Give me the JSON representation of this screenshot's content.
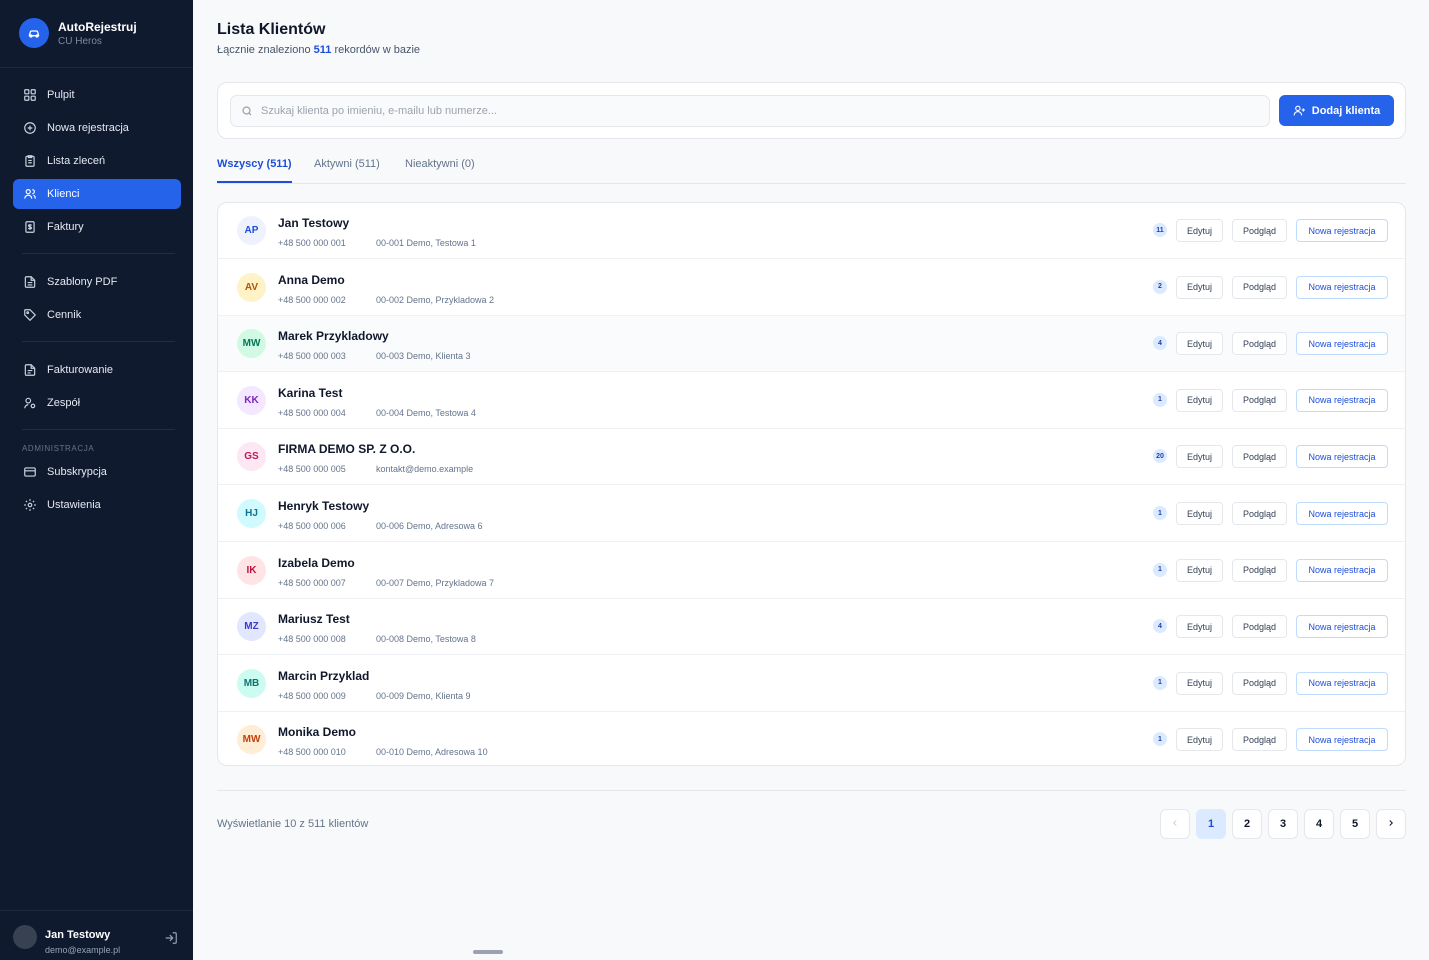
{
  "brand": {
    "title": "AutoRejestruj",
    "subtitle": "CU Heros",
    "icon": "car-icon"
  },
  "nav": {
    "items": [
      {
        "label": "Pulpit",
        "icon": "grid-icon"
      },
      {
        "label": "Nowa rejestracja",
        "icon": "plus-circle-icon"
      },
      {
        "label": "Lista zleceń",
        "icon": "clipboard-icon"
      },
      {
        "label": "Klienci",
        "icon": "users-icon",
        "active": true
      },
      {
        "label": "Faktury",
        "icon": "invoice-icon"
      },
      {
        "label": "Szablony PDF",
        "icon": "file-icon"
      },
      {
        "label": "Cennik",
        "icon": "tag-icon"
      },
      {
        "label": "Fakturowanie",
        "icon": "file-text-icon"
      },
      {
        "label": "Zespół",
        "icon": "user-gear-icon"
      },
      {
        "label": "Subskrypcja",
        "icon": "card-icon"
      },
      {
        "label": "Ustawienia",
        "icon": "gear-icon"
      }
    ],
    "section_admin": "ADMINISTRACJA"
  },
  "user": {
    "name": "Jan Testowy",
    "email": "demo@example.pl",
    "logout_icon": "logout-icon"
  },
  "header": {
    "title": "Lista Klientów",
    "subtitle_prefix": "Łącznie znaleziono",
    "count": "511",
    "subtitle_suffix": "rekordów w bazie"
  },
  "search": {
    "placeholder": "Szukaj klienta po imieniu, e-mailu lub numerze...",
    "value": ""
  },
  "add_button": "Dodaj klienta",
  "tabs": [
    {
      "label": "Wszyscy (511)",
      "active": true
    },
    {
      "label": "Aktywni (511)"
    },
    {
      "label": "Nieaktywni (0)"
    }
  ],
  "actions": {
    "edit": "Edytuj",
    "view": "Podgląd",
    "new": "Nowa rejestracja"
  },
  "clients": [
    {
      "initials": "AP",
      "name": "Jan Testowy",
      "phone": "+48 500 000 001",
      "detail": "00-001 Demo, Testowa 1",
      "count": "11",
      "bg": "#eef2ff",
      "fg": "#1d4ed8"
    },
    {
      "initials": "AV",
      "name": "Anna Demo",
      "phone": "+48 500 000 002",
      "detail": "00-002 Demo, Przykladowa 2",
      "count": "2",
      "bg": "#fef3c7",
      "fg": "#b45309"
    },
    {
      "initials": "MW",
      "name": "Marek Przykladowy",
      "phone": "+48 500 000 003",
      "detail": "00-003 Demo, Klienta 3",
      "count": "4",
      "bg": "#d1fae5",
      "fg": "#047857"
    },
    {
      "initials": "KK",
      "name": "Karina Test",
      "phone": "+48 500 000 004",
      "detail": "00-004 Demo, Testowa 4",
      "count": "1",
      "bg": "#f3e8ff",
      "fg": "#7e22ce"
    },
    {
      "initials": "GS",
      "name": "FIRMA DEMO SP. Z O.O.",
      "phone": "+48 500 000 005",
      "detail": "kontakt@demo.example",
      "count": "20",
      "bg": "#fce7f3",
      "fg": "#be185d"
    },
    {
      "initials": "HJ",
      "name": "Henryk Testowy",
      "phone": "+48 500 000 006",
      "detail": "00-006 Demo, Adresowa 6",
      "count": "1",
      "bg": "#cffafe",
      "fg": "#0e7490"
    },
    {
      "initials": "IK",
      "name": "Izabela Demo",
      "phone": "+48 500 000 007",
      "detail": "00-007 Demo, Przykladowa 7",
      "count": "1",
      "bg": "#ffe4e6",
      "fg": "#be123c"
    },
    {
      "initials": "MZ",
      "name": "Mariusz Test",
      "phone": "+48 500 000 008",
      "detail": "00-008 Demo, Testowa 8",
      "count": "4",
      "bg": "#e0e7ff",
      "fg": "#4338ca"
    },
    {
      "initials": "MB",
      "name": "Marcin Przyklad",
      "phone": "+48 500 000 009",
      "detail": "00-009 Demo, Klienta 9",
      "count": "1",
      "bg": "#ccfbf1",
      "fg": "#0f766e"
    },
    {
      "initials": "MW",
      "name": "Monika Demo",
      "phone": "+48 500 000 010",
      "detail": "00-010 Demo, Adresowa 10",
      "count": "1",
      "bg": "#ffedd5",
      "fg": "#c2410c"
    }
  ],
  "pagination": {
    "showing": "Wyświetlanie 10 z 511 klientów",
    "pages": [
      "1",
      "2",
      "3",
      "4",
      "5"
    ],
    "current": "1",
    "prev_icon": "chevron-left-icon",
    "next_icon": "chevron-right-icon"
  },
  "colors": {
    "sidebar": "#0f1a2e",
    "accent": "#2563eb"
  }
}
